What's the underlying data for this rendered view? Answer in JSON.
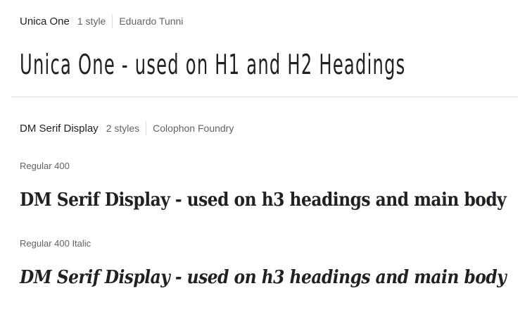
{
  "families": [
    {
      "name": "Unica One",
      "styles_count": "1 style",
      "designer": "Eduardo Tunni",
      "samples": [
        {
          "style_label": "",
          "text": "Unica One - used on H1 and H2 Headings"
        }
      ]
    },
    {
      "name": "DM Serif Display",
      "styles_count": "2 styles",
      "designer": "Colophon Foundry",
      "samples": [
        {
          "style_label": "Regular 400",
          "text": "DM Serif Display - used on h3 headings and main body"
        },
        {
          "style_label": "Regular 400 Italic",
          "text": "DM Serif Display - used on h3 headings and main body"
        }
      ]
    }
  ]
}
